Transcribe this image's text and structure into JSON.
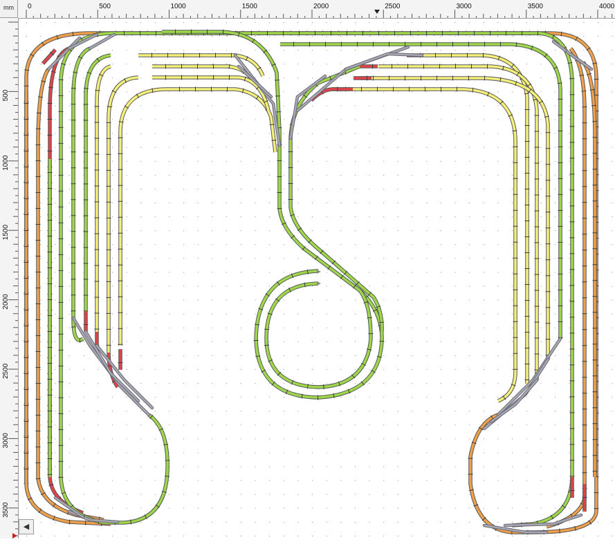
{
  "ruler": {
    "unit": "mm",
    "x_ticks": [
      "0",
      "500",
      "1000",
      "1500",
      "2000",
      "2500",
      "3000",
      "3500",
      "4000"
    ],
    "y_ticks": [
      "500",
      "1000",
      "1500",
      "2000",
      "2500",
      "3000",
      "3500"
    ]
  },
  "colors": {
    "track_green": "#9ed84a",
    "track_yellow": "#f4f07a",
    "track_orange": "#f0a04a",
    "track_red": "#e0444a",
    "turnout_gray": "#a8a8b4",
    "track_outline": "#555555"
  },
  "icons": {
    "scroll_left": "◀"
  }
}
